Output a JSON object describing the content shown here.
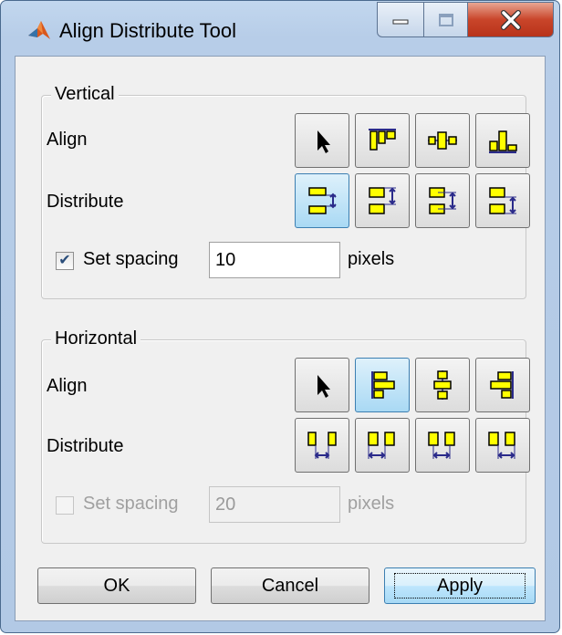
{
  "window": {
    "title": "Align Distribute Tool"
  },
  "title_controls": [
    {
      "name": "minimize-button",
      "icon": "minimize-icon"
    },
    {
      "name": "maximize-button",
      "icon": "maximize-icon"
    },
    {
      "name": "close-button",
      "icon": "close-icon"
    }
  ],
  "vertical": {
    "title": "Vertical",
    "align_label": "Align",
    "distribute_label": "Distribute",
    "align_buttons": [
      "pointer-icon",
      "align-top-icon",
      "align-vertical-center-icon",
      "align-bottom-icon"
    ],
    "distribute_buttons": [
      "distribute-vertical-spacing-icon",
      "distribute-top-icon",
      "distribute-middle-icon",
      "distribute-bottom-icon"
    ],
    "active_distribute_index": 0,
    "spacing": {
      "checked": true,
      "label": "Set spacing",
      "value": "10",
      "unit": "pixels"
    }
  },
  "horizontal": {
    "title": "Horizontal",
    "align_label": "Align",
    "distribute_label": "Distribute",
    "align_buttons": [
      "pointer-icon",
      "align-left-icon",
      "align-horizontal-center-icon",
      "align-right-icon"
    ],
    "distribute_buttons": [
      "distribute-horizontal-spacing-icon",
      "distribute-left-icon",
      "distribute-center-icon",
      "distribute-right-icon"
    ],
    "active_align_index": 1,
    "spacing": {
      "checked": false,
      "enabled": false,
      "label": "Set spacing",
      "value": "20",
      "unit": "pixels"
    }
  },
  "buttons": {
    "ok": "OK",
    "cancel": "Cancel",
    "apply": "Apply"
  },
  "colors": {
    "icon_fill": "#ffff00",
    "icon_stroke": "#2a2a8a",
    "arrow": "#2a2a8a",
    "accent": "#3c7fb1"
  }
}
